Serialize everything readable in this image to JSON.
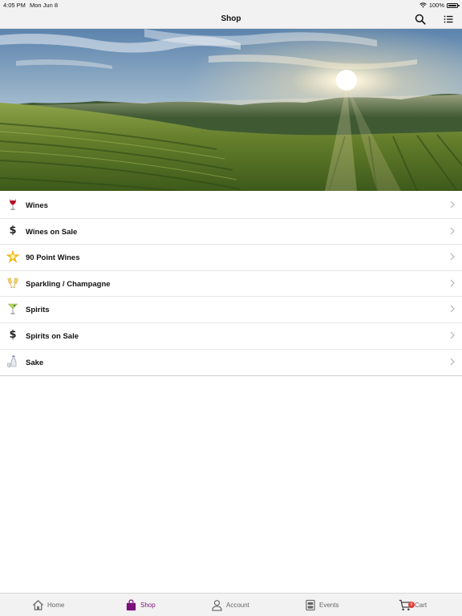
{
  "status": {
    "time": "4:05 PM",
    "date": "Mon Jun 8",
    "battery": "100%"
  },
  "header": {
    "title": "Shop"
  },
  "menu": {
    "items": [
      {
        "label": "Wines",
        "icon": "wine-glass-icon"
      },
      {
        "label": "Wines on Sale",
        "icon": "dollar-sign-icon"
      },
      {
        "label": "90 Point Wines",
        "icon": "star-icon"
      },
      {
        "label": "Sparkling / Champagne",
        "icon": "champagne-glasses-icon"
      },
      {
        "label": "Spirits",
        "icon": "cocktail-icon"
      },
      {
        "label": "Spirits on Sale",
        "icon": "dollar-sign-icon"
      },
      {
        "label": "Sake",
        "icon": "sake-bottle-icon"
      }
    ]
  },
  "tabs": [
    {
      "label": "Home",
      "icon": "home-icon",
      "active": false
    },
    {
      "label": "Shop",
      "icon": "shopping-bag-icon",
      "active": true
    },
    {
      "label": "Account",
      "icon": "person-icon",
      "active": false
    },
    {
      "label": "Events",
      "icon": "calendar-icon",
      "active": false
    },
    {
      "label": "Cart",
      "icon": "cart-icon",
      "active": false,
      "badge": "0"
    }
  ],
  "colors": {
    "accent": "#7b0f7b",
    "badge": "#e53935"
  }
}
